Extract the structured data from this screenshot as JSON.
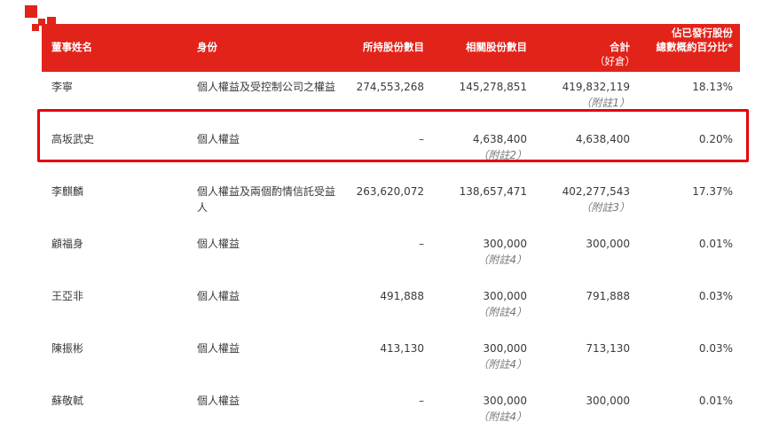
{
  "colors": {
    "brand_red": "#e2231a",
    "highlight": "#e8000b"
  },
  "header": {
    "name": "董事姓名",
    "capacity": "身份",
    "own_shares": "所持股份數目",
    "related_shares": "相關股份數目",
    "total_line1": "合計",
    "total_line2": "（好倉）",
    "pct_line1": "佔已發行股份",
    "pct_line2": "總數概約百分比*"
  },
  "rows": [
    {
      "name": "李寧",
      "capacity": "個人權益及受控制公司之權益",
      "own": "274,553,268",
      "related": "145,278,851",
      "related_note": "",
      "total": "419,832,119",
      "total_note": "（附註1）",
      "pct": "18.13%"
    },
    {
      "name": "高坂武史",
      "capacity": "個人權益",
      "own": "–",
      "related": "4,638,400",
      "related_note": "（附註2）",
      "total": "4,638,400",
      "total_note": "",
      "pct": "0.20%"
    },
    {
      "name": "李麒麟",
      "capacity": "個人權益及兩個酌情信託受益人",
      "own": "263,620,072",
      "related": "138,657,471",
      "related_note": "",
      "total": "402,277,543",
      "total_note": "（附註3）",
      "pct": "17.37%"
    },
    {
      "name": "顧福身",
      "capacity": "個人權益",
      "own": "–",
      "related": "300,000",
      "related_note": "（附註4）",
      "total": "300,000",
      "total_note": "",
      "pct": "0.01%"
    },
    {
      "name": "王亞非",
      "capacity": "個人權益",
      "own": "491,888",
      "related": "300,000",
      "related_note": "（附註4）",
      "total": "791,888",
      "total_note": "",
      "pct": "0.03%"
    },
    {
      "name": "陳振彬",
      "capacity": "個人權益",
      "own": "413,130",
      "related": "300,000",
      "related_note": "（附註4）",
      "total": "713,130",
      "total_note": "",
      "pct": "0.03%"
    },
    {
      "name": "蘇敬軾",
      "capacity": "個人權益",
      "own": "–",
      "related": "300,000",
      "related_note": "（附註4）",
      "total": "300,000",
      "total_note": "",
      "pct": "0.01%"
    }
  ]
}
